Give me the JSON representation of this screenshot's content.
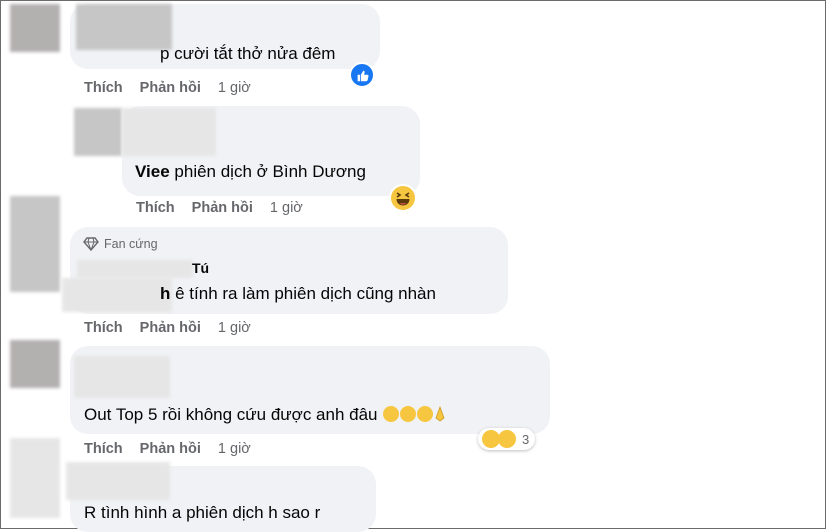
{
  "actions": {
    "like": "Thích",
    "reply": "Phản hồi"
  },
  "comments": [
    {
      "text": "p cười tắt thở nửa đêm",
      "time": "1 giờ",
      "reaction": "like-icon"
    },
    {
      "author": "Viee",
      "text": "phiên dịch ở Bình Dương",
      "time": "1 giờ",
      "reaction": "haha-icon"
    },
    {
      "badge": "Fan cứng",
      "name_suffix": "Tú",
      "text_prefix": "h",
      "text": "ê tính ra làm phiên dịch cũng nhàn",
      "time": "1 giờ"
    },
    {
      "text": "Out Top 5 rồi không cứu được anh đâu",
      "emojis": [
        "dizzy-face-icon",
        "laughing-tears-icon",
        "laughing-tears-icon",
        "folded-hands-icon"
      ],
      "time": "1 giờ",
      "reactions": [
        "sad-icon",
        "haha-icon"
      ],
      "reaction_count": "3"
    },
    {
      "text": "R tình hình a phiên dịch h sao r"
    }
  ],
  "colors": {
    "bubble": "#f0f2f5",
    "meta": "#65676b",
    "like": "#1877f2",
    "haha": "#f7c640"
  }
}
